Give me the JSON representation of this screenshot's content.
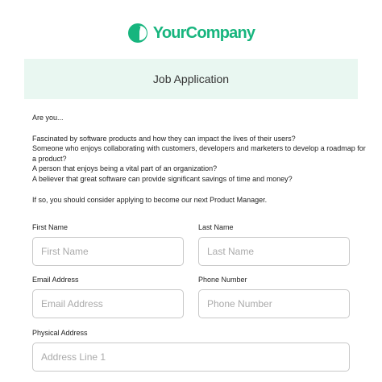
{
  "brand": {
    "name": "YourCompany",
    "color": "#17b57e"
  },
  "header": {
    "title": "Job Application",
    "band_color": "#e9f7f1"
  },
  "intro": {
    "question": "Are you...",
    "items": [
      "Fascinated by software products and how they can impact the lives of their users?",
      "Someone who enjoys collaborating with customers, developers and marketers to develop a roadmap for a product?",
      "A person that enjoys being a vital part of an organization?",
      "A believer that great software can provide significant savings of time and money?"
    ],
    "closing": "If so, you should consider applying to become our next Product Manager."
  },
  "form": {
    "first_name": {
      "label": "First Name",
      "placeholder": "First Name",
      "value": ""
    },
    "last_name": {
      "label": "Last Name",
      "placeholder": "Last Name",
      "value": ""
    },
    "email": {
      "label": "Email Address",
      "placeholder": "Email Address",
      "value": ""
    },
    "phone": {
      "label": "Phone Number",
      "placeholder": "Phone Number",
      "value": ""
    },
    "address": {
      "label": "Physical Address",
      "placeholder": "Address Line 1",
      "value": ""
    }
  }
}
